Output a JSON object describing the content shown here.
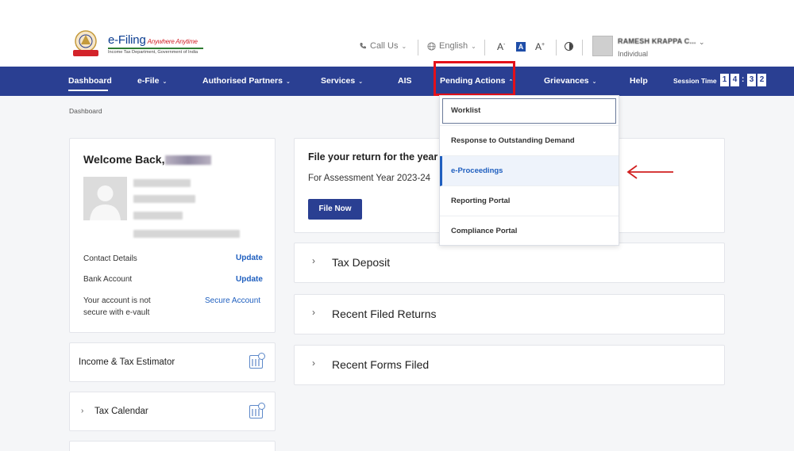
{
  "header": {
    "logo_title": "e-Filing",
    "logo_tagline": "Anywhere Anytime",
    "logo_subtitle": "Income Tax Department, Government of India",
    "call_us": "Call Us",
    "language": "English",
    "font_decrease": "A",
    "font_default": "A",
    "font_increase": "A",
    "user_name": "RAMESH KRAPPA C...",
    "user_role": "Individual"
  },
  "nav": {
    "items": [
      {
        "label": "Dashboard"
      },
      {
        "label": "e-File"
      },
      {
        "label": "Authorised Partners"
      },
      {
        "label": "Services"
      },
      {
        "label": "AIS"
      },
      {
        "label": "Pending Actions"
      },
      {
        "label": "Grievances"
      },
      {
        "label": "Help"
      }
    ],
    "session_label": "Session Time",
    "session_digits": [
      "1",
      "4",
      "3",
      "2"
    ],
    "session_colon": ":"
  },
  "breadcrumb": "Dashboard",
  "welcome": {
    "title": "Welcome Back,",
    "rows": [
      {
        "label": "Contact Details",
        "action": "Update"
      },
      {
        "label": "Bank Account",
        "action": "Update"
      },
      {
        "label": "Your account is not",
        "label2": "secure with e-vault",
        "action": "Secure Account"
      }
    ]
  },
  "side_cards": [
    {
      "title": "Income & Tax Estimator",
      "icon": "calculator-icon"
    },
    {
      "title": "Tax Calendar",
      "icon": "calendar-icon"
    }
  ],
  "file_return": {
    "title": "File your return for the year e",
    "assessment": "For Assessment Year 2023-24",
    "button": "File Now"
  },
  "accordions": [
    {
      "title": "Tax Deposit"
    },
    {
      "title": "Recent Filed Returns"
    },
    {
      "title": "Recent Forms Filed"
    }
  ],
  "dropdown": {
    "items": [
      {
        "label": "Worklist"
      },
      {
        "label": "Response to Outstanding Demand"
      },
      {
        "label": "e-Proceedings"
      },
      {
        "label": "Reporting Portal"
      },
      {
        "label": "Compliance Portal"
      }
    ]
  },
  "colors": {
    "nav_bg": "#2a3f92",
    "highlight": "#e3101a",
    "link": "#1f5fbf",
    "annotation_arrow": "#d11f1f"
  }
}
